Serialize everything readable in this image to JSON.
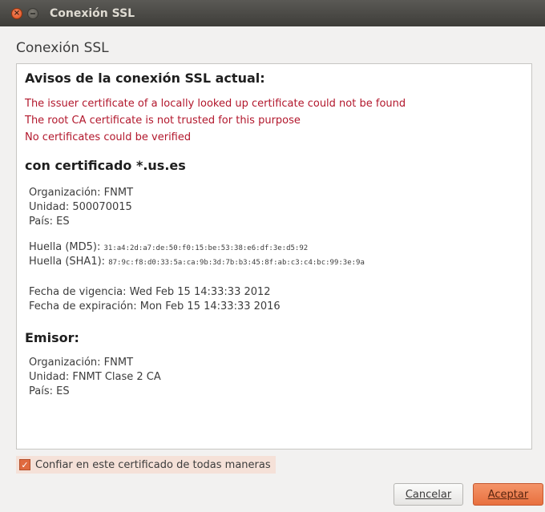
{
  "window": {
    "title": "Conexión SSL",
    "close_glyph": "×"
  },
  "dialog": {
    "heading": "Conexión SSL"
  },
  "warnings": {
    "heading": "Avisos de la conexión SSL actual:",
    "items": [
      "The issuer certificate of a locally looked up certificate could not be found",
      "The root CA certificate is not trusted for this purpose",
      "No certificates could be verified"
    ]
  },
  "certificate": {
    "heading": "con certificado *.us.es",
    "organization": "Organización: FNMT",
    "unit": "Unidad: 500070015",
    "country": "País: ES",
    "md5_label": "Huella (MD5):",
    "md5_value": "31:a4:2d:a7:de:50:f0:15:be:53:38:e6:df:3e:d5:92",
    "sha1_label": "Huella (SHA1):",
    "sha1_value": "87:9c:f8:d0:33:5a:ca:9b:3d:7b:b3:45:8f:ab:c3:c4:bc:99:3e:9a",
    "valid_from": "Fecha de vigencia: Wed Feb 15 14:33:33 2012",
    "valid_to": "Fecha de expiración: Mon Feb 15 14:33:33 2016"
  },
  "issuer": {
    "heading": "Emisor:",
    "organization": "Organización: FNMT",
    "unit": "Unidad: FNMT Clase 2 CA",
    "country": "País: ES"
  },
  "trust_checkbox": {
    "label": "Confiar en este certificado de todas maneras",
    "checked": true,
    "check_glyph": "✓"
  },
  "buttons": {
    "cancel": "Cancelar",
    "accept": "Aceptar"
  },
  "colors": {
    "titlebar": "#3e3d39",
    "warning_text": "#b2172c",
    "accent": "#e8703f"
  }
}
